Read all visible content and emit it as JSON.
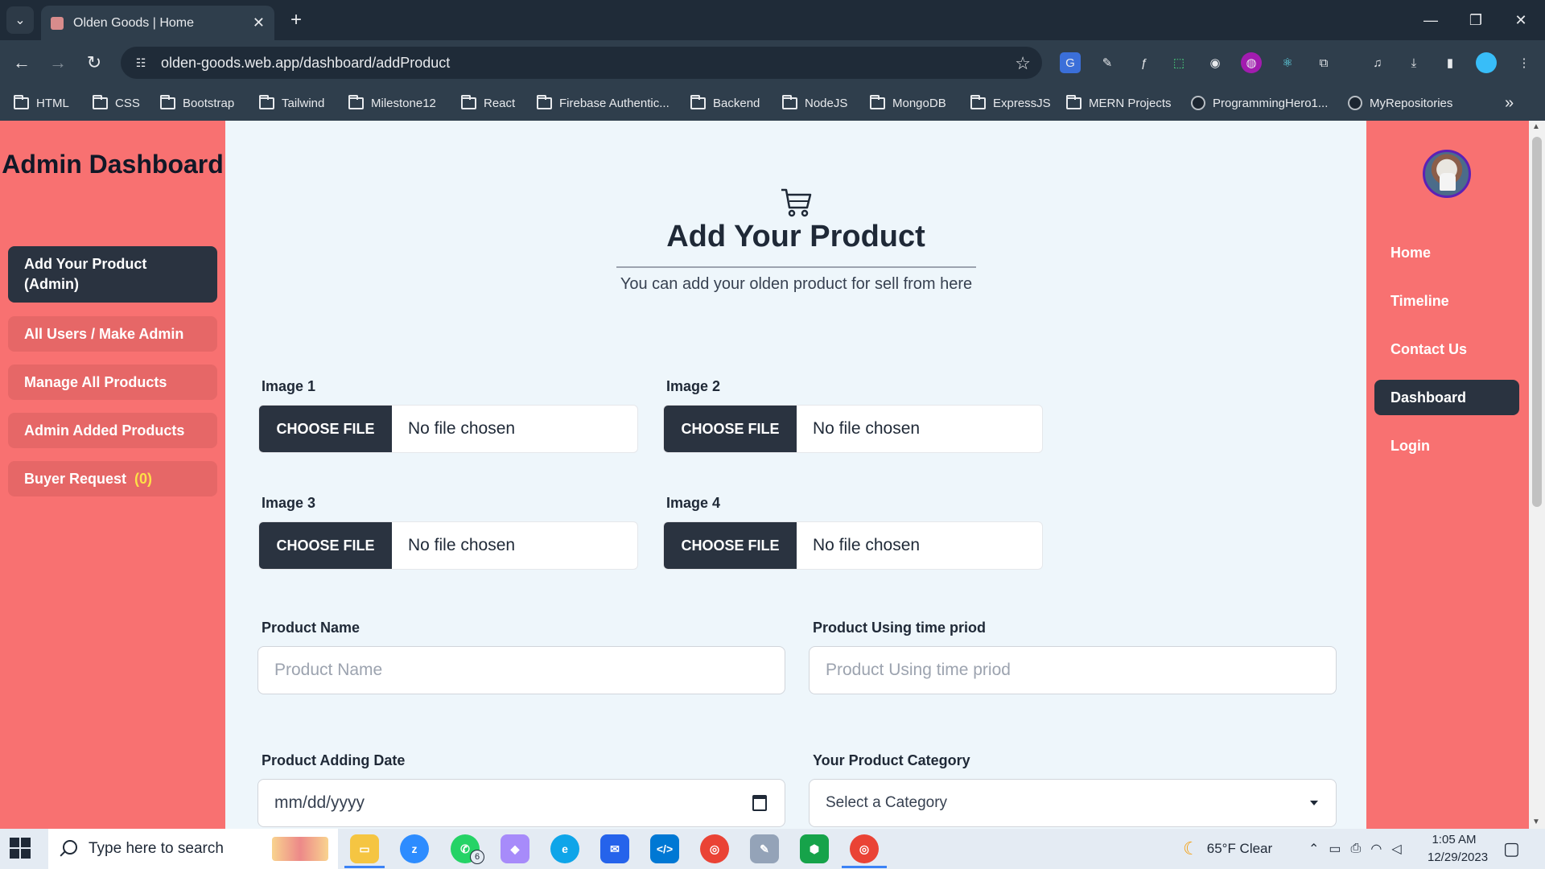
{
  "browser": {
    "tab_title": "Olden Goods | Home",
    "tab_close": "✕",
    "new_tab": "+",
    "url": "olden-goods.web.app/dashboard/addProduct",
    "bookmarks": [
      "HTML",
      "CSS",
      "Bootstrap",
      "Tailwind",
      "Milestone12",
      "React",
      "Firebase Authentic...",
      "Backend",
      "NodeJS",
      "MongoDB",
      "ExpressJS",
      "MERN Projects",
      "ProgrammingHero1...",
      "MyRepositories"
    ],
    "overflow": "»"
  },
  "sidebar": {
    "title": "Admin Dashboard",
    "items": [
      {
        "label": "Add Your Product (Admin)"
      },
      {
        "label": "All Users / Make Admin"
      },
      {
        "label": "Manage All Products"
      },
      {
        "label": "Admin Added Products"
      },
      {
        "label": "Buyer Request",
        "count": "(0)"
      }
    ]
  },
  "right_nav": {
    "items": [
      "Home",
      "Timeline",
      "Contact Us",
      "Dashboard",
      "Login"
    ]
  },
  "form": {
    "title": "Add Your Product",
    "subtitle": "You can add your olden product for sell from here",
    "images": [
      {
        "label": "Image 1",
        "button": "CHOOSE FILE",
        "status": "No file chosen"
      },
      {
        "label": "Image 2",
        "button": "CHOOSE FILE",
        "status": "No file chosen"
      },
      {
        "label": "Image 3",
        "button": "CHOOSE FILE",
        "status": "No file chosen"
      },
      {
        "label": "Image 4",
        "button": "CHOOSE FILE",
        "status": "No file chosen"
      }
    ],
    "product_name": {
      "label": "Product Name",
      "placeholder": "Product Name"
    },
    "using_time": {
      "label": "Product Using time priod",
      "placeholder": "Product Using time priod"
    },
    "adding_date": {
      "label": "Product Adding Date",
      "placeholder": "mm/dd/yyyy"
    },
    "category": {
      "label": "Your Product Category",
      "selected": "Select a Category"
    }
  },
  "taskbar": {
    "search_placeholder": "Type here to search",
    "whatsapp_badge": "6",
    "weather": "65°F  Clear",
    "time": "1:05 AM",
    "date": "12/29/2023"
  },
  "colors": {
    "sidebar_bg": "#f87171",
    "active_dark": "#2a3340",
    "page_bg": "#eef6fb",
    "accent_count": "#fde047"
  }
}
